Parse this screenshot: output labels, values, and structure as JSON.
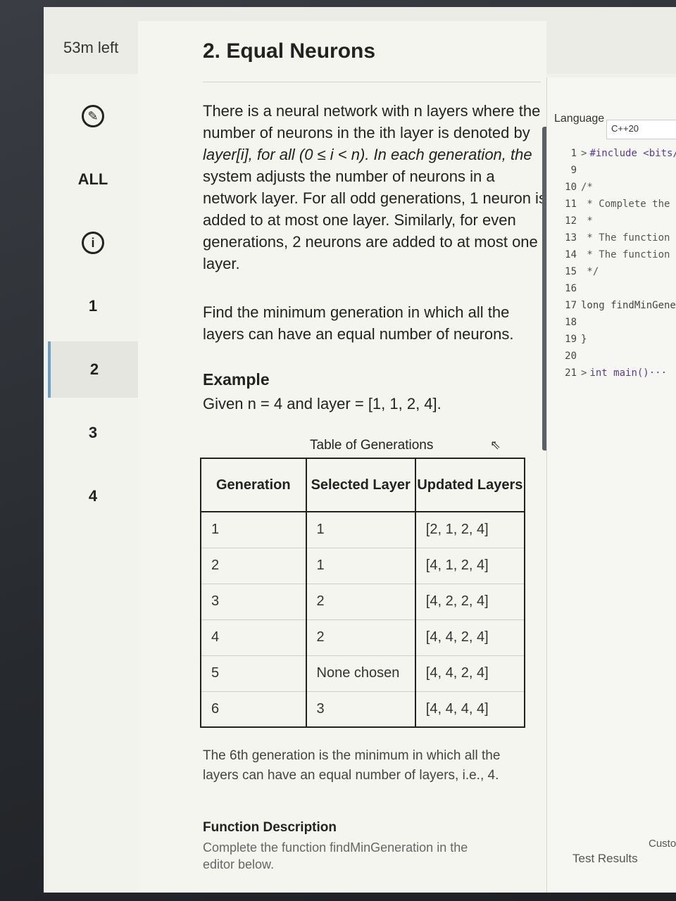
{
  "header": {
    "time_left": "53m left"
  },
  "sidebar": {
    "items": [
      {
        "label": "ALL"
      },
      {
        "label": "1"
      },
      {
        "label": "2"
      },
      {
        "label": "3"
      },
      {
        "label": "4"
      }
    ],
    "active_index": 2
  },
  "problem": {
    "title": "2. Equal Neurons",
    "intro_line1": "There is a neural network with n layers where the",
    "intro_line2": "number of neurons in the ith layer is denoted by",
    "intro_line3": "layer[i], for all (0 ≤ i < n). In each generation, the",
    "intro_line4": "system adjusts the number of neurons in a",
    "intro_line5": "network layer. For all odd generations, 1 neuron is",
    "intro_line6": "added to at most one layer. Similarly, for even",
    "intro_line7": "generations, 2 neurons are added to at most one",
    "intro_line8": "layer.",
    "task_line1": "Find the minimum generation in which all the",
    "task_line2": "layers can have an equal number of neurons.",
    "example_heading": "Example",
    "example_text": "Given n = 4 and layer = [1, 1, 2, 4].",
    "table_caption": "Table of Generations",
    "table_headers": [
      "Generation",
      "Selected Layer",
      "Updated Layers"
    ],
    "table_rows": [
      [
        "1",
        "1",
        "[2, 1, 2, 4]"
      ],
      [
        "2",
        "1",
        "[4, 1, 2, 4]"
      ],
      [
        "3",
        "2",
        "[4, 2, 2, 4]"
      ],
      [
        "4",
        "2",
        "[4, 4, 2, 4]"
      ],
      [
        "5",
        "None chosen",
        "[4, 4, 2, 4]"
      ],
      [
        "6",
        "3",
        "[4, 4, 4, 4]"
      ]
    ],
    "conclusion_line1": "The 6th generation is the minimum in which all the",
    "conclusion_line2": "layers can have an equal number of layers, i.e., 4.",
    "function_heading": "Function Description",
    "function_text": "Complete the function findMinGeneration in the",
    "function_text2": "editor below."
  },
  "editor": {
    "language_label": "Language",
    "language_value": "C++20",
    "lines": [
      {
        "num": "1",
        "fold": ">",
        "code": "#include <bits/"
      },
      {
        "num": "9",
        "fold": "",
        "code": ""
      },
      {
        "num": "10",
        "fold": "",
        "code": "/*"
      },
      {
        "num": "11",
        "fold": "",
        "code": " * Complete the"
      },
      {
        "num": "12",
        "fold": "",
        "code": " *"
      },
      {
        "num": "13",
        "fold": "",
        "code": " * The function"
      },
      {
        "num": "14",
        "fold": "",
        "code": " * The function"
      },
      {
        "num": "15",
        "fold": "",
        "code": " */"
      },
      {
        "num": "16",
        "fold": "",
        "code": ""
      },
      {
        "num": "17",
        "fold": "",
        "code": "long findMinGene"
      },
      {
        "num": "18",
        "fold": "",
        "code": ""
      },
      {
        "num": "19",
        "fold": "",
        "code": "}"
      },
      {
        "num": "20",
        "fold": "",
        "code": ""
      },
      {
        "num": "21",
        "fold": ">",
        "code": "int main()···"
      }
    ],
    "test_results": "Test Results",
    "custom": "Custom"
  }
}
